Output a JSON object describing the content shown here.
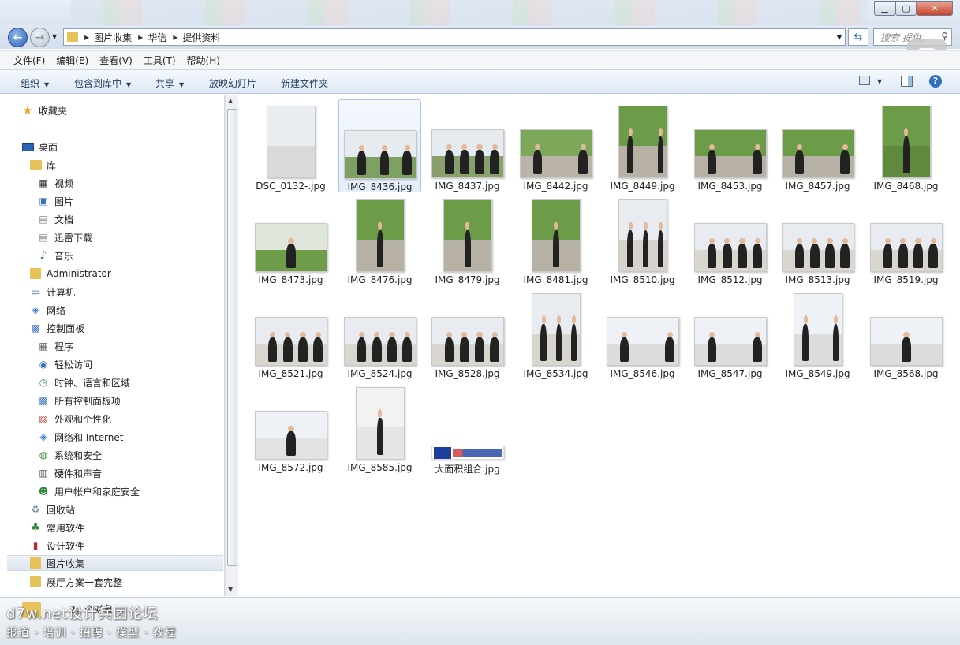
{
  "window": {
    "minimize": "▁",
    "maximize": "▢",
    "close": "✕"
  },
  "address": {
    "crumbs": [
      "图片收集",
      "华信",
      "提供资料"
    ]
  },
  "search": {
    "placeholder": "搜索 提供..."
  },
  "menu": [
    "文件(F)",
    "编辑(E)",
    "查看(V)",
    "工具(T)",
    "帮助(H)"
  ],
  "toolbar": {
    "organize": "组织",
    "include": "包含到库中",
    "share": "共享",
    "slideshow": "放映幻灯片",
    "newfolder": "新建文件夹"
  },
  "nav": [
    {
      "label": "收藏夹",
      "icon": "star-icon"
    },
    {
      "label": "桌面",
      "icon": "desktop-icon"
    },
    {
      "label": "库",
      "icon": "library-icon"
    },
    {
      "label": "视频",
      "icon": "video-icon"
    },
    {
      "label": "图片",
      "icon": "pictures-icon"
    },
    {
      "label": "文档",
      "icon": "documents-icon"
    },
    {
      "label": "迅雷下载",
      "icon": "documents-icon"
    },
    {
      "label": "音乐",
      "icon": "music-icon"
    },
    {
      "label": "Administrator",
      "icon": "user-folder-icon"
    },
    {
      "label": "计算机",
      "icon": "computer-icon"
    },
    {
      "label": "网络",
      "icon": "network-icon"
    },
    {
      "label": "控制面板",
      "icon": "control-panel-icon"
    },
    {
      "label": "程序",
      "icon": "programs-icon"
    },
    {
      "label": "轻松访问",
      "icon": "ease-access-icon"
    },
    {
      "label": "时钟、语言和区域",
      "icon": "clock-icon"
    },
    {
      "label": "所有控制面板项",
      "icon": "control-panel-icon"
    },
    {
      "label": "外观和个性化",
      "icon": "appearance-icon"
    },
    {
      "label": "网络和 Internet",
      "icon": "network-icon"
    },
    {
      "label": "系统和安全",
      "icon": "security-icon"
    },
    {
      "label": "硬件和声音",
      "icon": "hardware-icon"
    },
    {
      "label": "用户帐户和家庭安全",
      "icon": "users-icon"
    },
    {
      "label": "回收站",
      "icon": "recycle-bin-icon"
    },
    {
      "label": "常用软件",
      "icon": "tree-icon"
    },
    {
      "label": "设计软件",
      "icon": "book-icon"
    },
    {
      "label": "图片收集",
      "icon": "folder-icon"
    },
    {
      "label": "展厅方案一套完整",
      "icon": "folder-icon"
    }
  ],
  "files": [
    {
      "name": "DSC_0132-.jpg"
    },
    {
      "name": "IMG_8436.jpg"
    },
    {
      "name": "IMG_8437.jpg"
    },
    {
      "name": "IMG_8442.jpg"
    },
    {
      "name": "IMG_8449.jpg"
    },
    {
      "name": "IMG_8453.jpg"
    },
    {
      "name": "IMG_8457.jpg"
    },
    {
      "name": "IMG_8468.jpg"
    },
    {
      "name": "IMG_8473.jpg"
    },
    {
      "name": "IMG_8476.jpg"
    },
    {
      "name": "IMG_8479.jpg"
    },
    {
      "name": "IMG_8481.jpg"
    },
    {
      "name": "IMG_8510.jpg"
    },
    {
      "name": "IMG_8512.jpg"
    },
    {
      "name": "IMG_8513.jpg"
    },
    {
      "name": "IMG_8519.jpg"
    },
    {
      "name": "IMG_8521.jpg"
    },
    {
      "name": "IMG_8524.jpg"
    },
    {
      "name": "IMG_8528.jpg"
    },
    {
      "name": "IMG_8534.jpg"
    },
    {
      "name": "IMG_8546.jpg"
    },
    {
      "name": "IMG_8547.jpg"
    },
    {
      "name": "IMG_8549.jpg"
    },
    {
      "name": "IMG_8568.jpg"
    },
    {
      "name": "IMG_8572.jpg"
    },
    {
      "name": "IMG_8585.jpg"
    },
    {
      "name": "大面积组合.jpg"
    }
  ],
  "status": {
    "count": "27 个对象"
  },
  "watermark": {
    "line1": "d7w.net设计兵团论坛",
    "line2": "报道 · 培训 · 招聘 · 模型 · 教程"
  }
}
